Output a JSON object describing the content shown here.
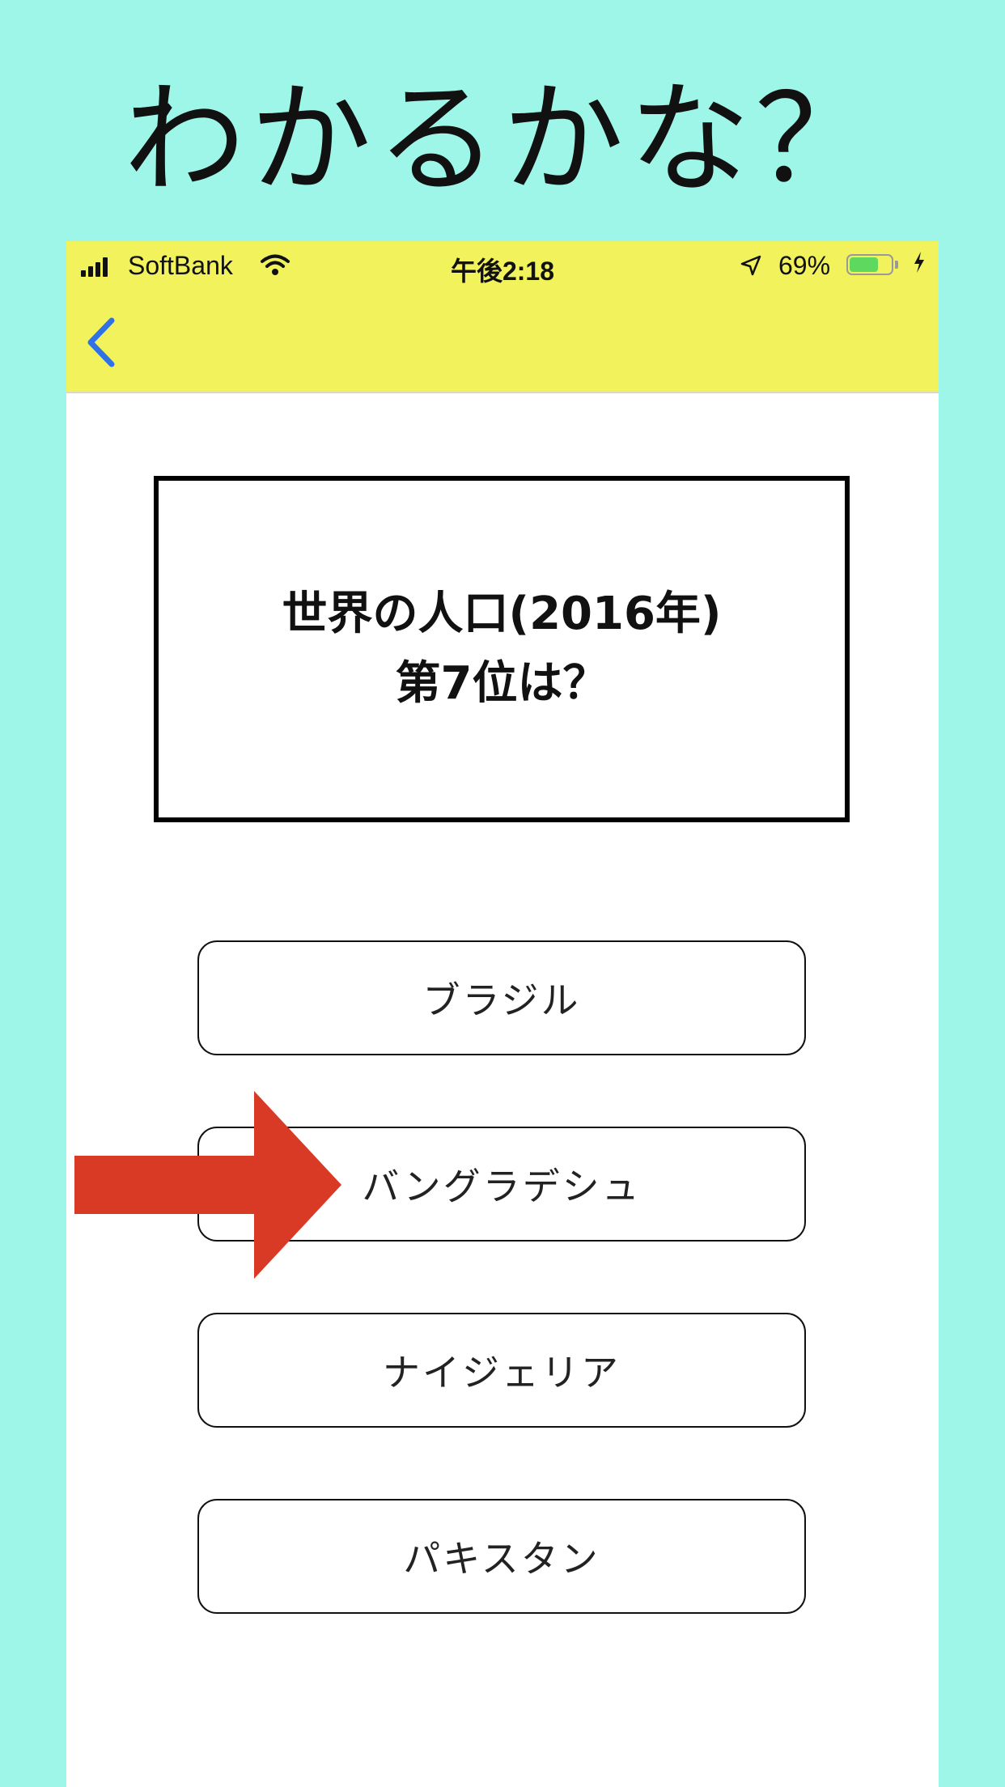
{
  "headline": "わかるかな？",
  "colors": {
    "page_background": "#9df6e8",
    "navbar_background": "#f1f25c",
    "back_chevron": "#2f72e8",
    "arrow": "#d93a26",
    "battery_fill": "#5ed85e"
  },
  "status_bar": {
    "carrier": "SoftBank",
    "time": "午後2:18",
    "battery_percent": "69%",
    "battery_level": 0.69,
    "icons": [
      "signal-icon",
      "wifi-icon",
      "location-icon",
      "battery-icon",
      "charging-icon"
    ]
  },
  "nav": {
    "back_icon": "chevron-left-icon"
  },
  "quiz": {
    "question_line1": "世界の人口(2016年)",
    "question_line2": "第7位は？",
    "answers": [
      {
        "label": "ブラジル"
      },
      {
        "label": "バングラデシュ"
      },
      {
        "label": "ナイジェリア"
      },
      {
        "label": "パキスタン"
      }
    ]
  },
  "annotation": {
    "icon": "arrow-right-icon",
    "points_to_answer_index": 1
  }
}
